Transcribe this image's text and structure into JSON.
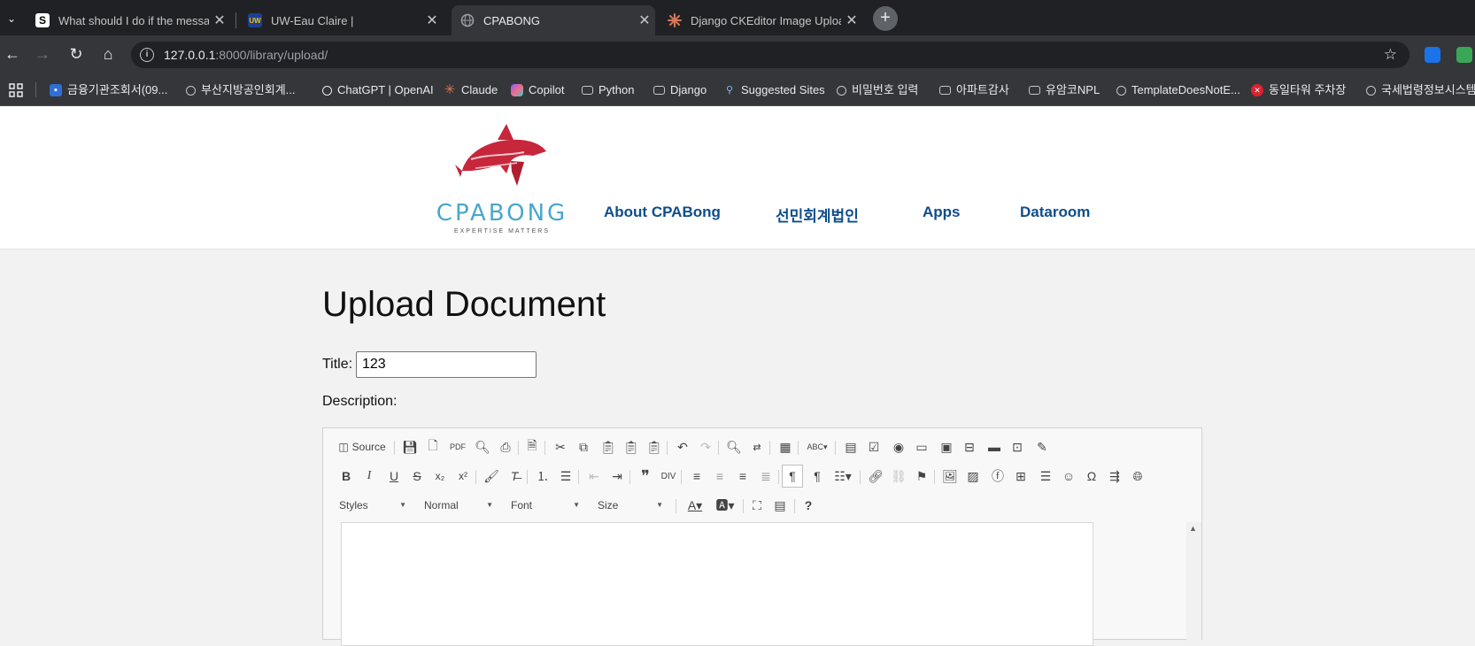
{
  "browser": {
    "tabs": [
      {
        "title": "What should I do if the messa",
        "favicon": "S",
        "active": false
      },
      {
        "title": "UW-Eau Claire |",
        "favicon": "UW",
        "active": false
      },
      {
        "title": "CPABONG",
        "favicon": "globe",
        "active": true
      },
      {
        "title": "Django CKEditor Image Uploa",
        "favicon": "claude-spark",
        "active": false
      }
    ],
    "tab_close": "✕",
    "new_tab": "+",
    "url_host": "127.0.0.1",
    "url_path": ":8000/library/upload/",
    "bookmarks": [
      {
        "label": "금융기관조회서(09...",
        "icon": "grid-logo"
      },
      {
        "label": "부산지방공인회계...",
        "icon": "globe"
      },
      {
        "label": "ChatGPT | OpenAI",
        "icon": "openai"
      },
      {
        "label": "Claude",
        "icon": "claude-spark"
      },
      {
        "label": "Copilot",
        "icon": "copilot"
      },
      {
        "label": "Python",
        "icon": "folder"
      },
      {
        "label": "Django",
        "icon": "folder"
      },
      {
        "label": "Suggested Sites",
        "icon": "search"
      },
      {
        "label": "비밀번호 입력",
        "icon": "globe"
      },
      {
        "label": "아파트감사",
        "icon": "folder"
      },
      {
        "label": "유암코NPL",
        "icon": "folder"
      },
      {
        "label": "TemplateDoesNotE...",
        "icon": "globe"
      },
      {
        "label": "동일타워 주차장",
        "icon": "x-logo"
      },
      {
        "label": "국세법령정보시스템",
        "icon": "globe"
      }
    ]
  },
  "site": {
    "logo_text": "CPABONG",
    "logo_tagline": "EXPERTISE MATTERS",
    "nav": [
      "About CPABong",
      "선민회계법인",
      "Apps",
      "Dataroom"
    ]
  },
  "form": {
    "heading": "Upload Document",
    "title_label": "Title:",
    "title_value": "123",
    "description_label": "Description:"
  },
  "editor": {
    "source_label": "Source",
    "combos": [
      "Styles",
      "Normal",
      "Font",
      "Size"
    ],
    "help": "?"
  },
  "colors": {
    "nav_link": "#0e4d8c",
    "logo_red": "#c8263b",
    "logo_blue": "#4aa7c9",
    "page_bg": "#f2f2f2"
  }
}
